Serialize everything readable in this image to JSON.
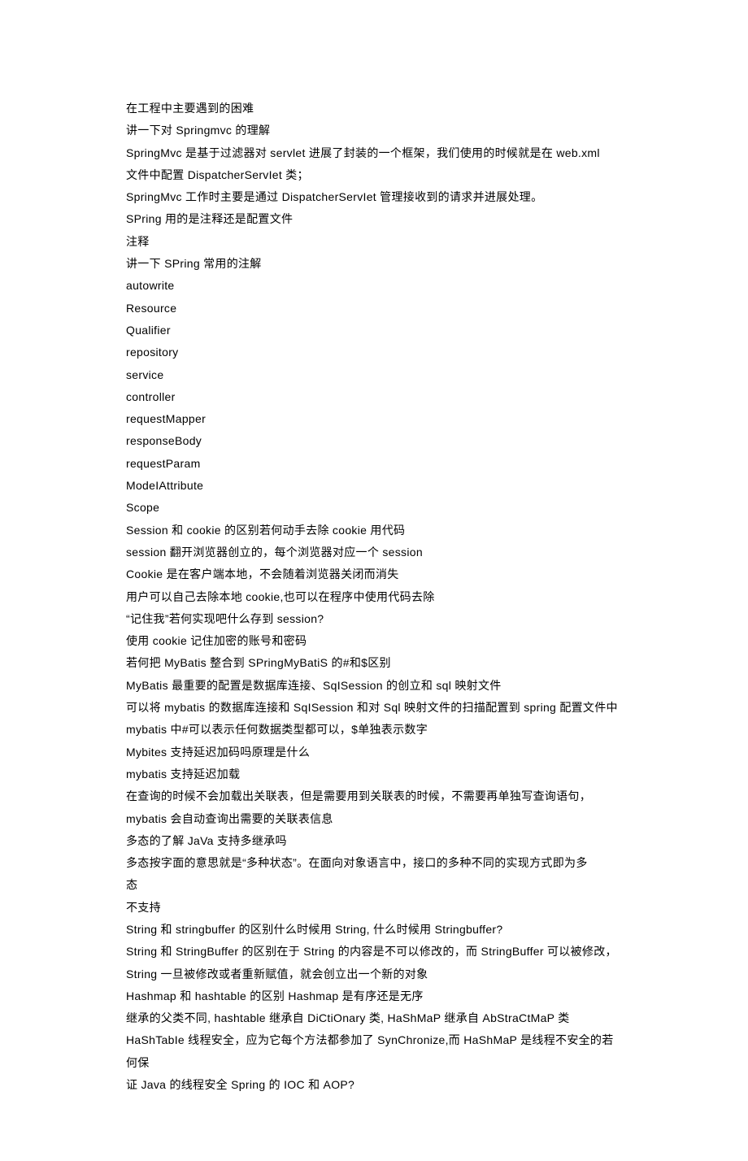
{
  "lines": [
    "在工程中主要遇到的困难",
    "讲一下对 Springmvc 的理解",
    "SpringMvc 是基于过滤器对 servlet 进展了封装的一个框架，我们使用的时候就是在 web.xml",
    "文件中配置 DispatcherServIet 类；",
    "SpringMvc 工作时主要是通过 DispatcherServIet 管理接收到的请求并进展处理。",
    "SPring 用的是注释还是配置文件",
    "注释",
    "讲一下 SPring 常用的注解",
    "autowrite",
    "Resource",
    "Qualifier",
    "repository",
    "service",
    "controller",
    "requestMapper",
    "responseBody",
    "requestParam",
    "ModeIAttribute",
    "Scope",
    "Session 和 cookie 的区别若何动手去除 cookie 用代码",
    "session 翻开浏览器创立的，每个浏览器对应一个 session",
    "Cookie 是在客户端本地，不会随着浏览器关闭而消失",
    "用户可以自己去除本地 cookie,也可以在程序中使用代码去除",
    "“记住我”若何实现吧什么存到 session?",
    "使用 cookie 记住加密的账号和密码",
    "若何把 MyBatis 整合到 SPringMyBatiS 的#和$区别",
    "MyBatis 最重要的配置是数据库连接、SqISession 的创立和 sql 映射文件",
    "可以将 mybatis 的数据库连接和 SqISession 和对 Sql 映射文件的扫描配置到 spring 配置文件中",
    "mybatis 中#可以表示任何数据类型都可以，$单独表示数字",
    "Mybites 支持延迟加码吗原理是什么",
    "mybatis 支持延迟加载",
    "在查询的时候不会加载出关联表，但是需要用到关联表的时候，不需要再单独写查询语句，",
    "mybatis 会自动查询出需要的关联表信息",
    "多态的了解 JaVa 支持多继承吗",
    "多态按字面的意思就是“多种状态”。在面向对象语言中，接口的多种不同的实现方式即为多",
    "态",
    "不支持",
    "String 和 stringbuffer 的区别什么时候用 String, 什么时候用 Stringbuffer?",
    "String 和 StringBuffer 的区别在于 String 的内容是不可以修改的，而 StringBuffer 可以被修改，",
    "String 一旦被修改或者重新赋值，就会创立出一个新的对象",
    "Hashmap 和 hashtable 的区别 Hashmap 是有序还是无序",
    "继承的父类不同, hashtable 继承自 DiCtiOnary 类, HaShMaP 继承自 AbStraCtMaP 类",
    "HaShTabIe 线程安全，应为它每个方法都参加了 SynChronize,而 HaShMaP 是线程不安全的若何保",
    "证 Java 的线程安全 Spring 的 IOC 和 AOP?"
  ]
}
